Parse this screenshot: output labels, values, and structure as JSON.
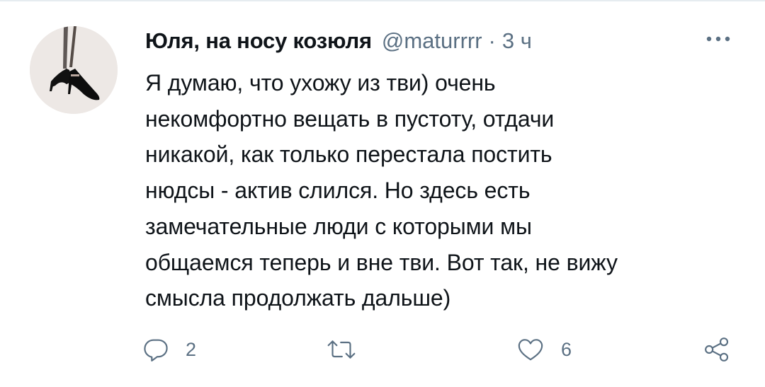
{
  "tweet": {
    "display_name": "Юля, на носу козюля",
    "handle": "@maturrrr",
    "separator": "·",
    "timestamp": "3 ч",
    "body_lines": [
      "Я думаю, что ухожу из тви) очень",
      "некомфортно вещать в пустоту, отдачи",
      "никакой, как только перестала постить",
      "нюдсы - актив слился. Но здесь есть",
      "замечательные люди с которыми мы",
      "общаемся теперь и вне тви. Вот так, не вижу",
      "смысла продолжать дальше)"
    ],
    "actions": {
      "reply_count": "2",
      "retweet_count": "",
      "like_count": "6"
    }
  },
  "icons": {
    "avatar": "avatar-photo",
    "more": "more-dots-icon",
    "reply": "reply-icon",
    "retweet": "retweet-icon",
    "like": "heart-icon",
    "share": "share-icon"
  },
  "colors": {
    "text_primary": "#0f1419",
    "text_secondary": "#5b7083",
    "divider": "#e6ecf0"
  }
}
